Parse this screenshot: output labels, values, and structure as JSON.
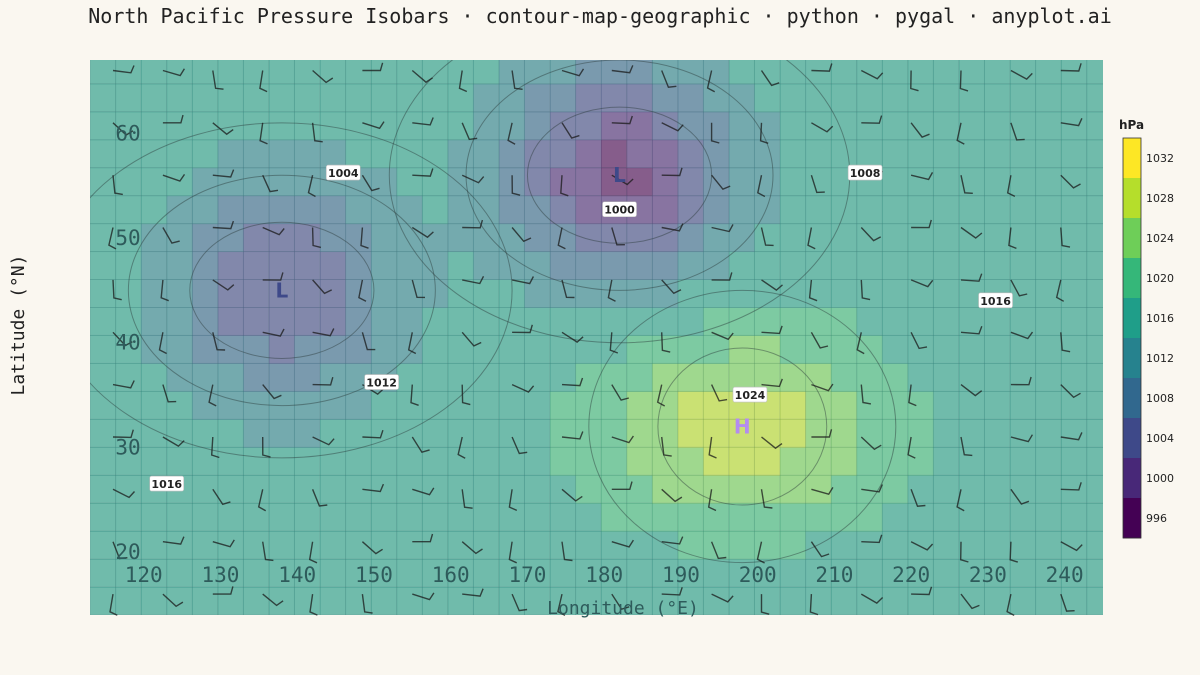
{
  "chart_data": {
    "type": "heatmap",
    "title": "North Pacific Pressure Isobars · contour-map-geographic · python · pygal · anyplot.ai",
    "xlabel": "Longitude (°E)",
    "ylabel": "Latitude (°N)",
    "xlim": [
      113,
      245
    ],
    "ylim": [
      14,
      67
    ],
    "x_ticks": [
      120,
      130,
      140,
      150,
      160,
      170,
      180,
      190,
      200,
      210,
      220,
      230,
      240
    ],
    "y_ticks": [
      20,
      30,
      40,
      50,
      60
    ],
    "grid": true,
    "colorbar": {
      "title": "hPa",
      "ticks": [
        "1032",
        "1028",
        "1024",
        "1020",
        "1016",
        "1012",
        "1008",
        "1004",
        "1000",
        "996"
      ],
      "range": [
        994,
        1034
      ],
      "colors": [
        "#440154",
        "#482878",
        "#3e4989",
        "#31688e",
        "#26828e",
        "#1f9e89",
        "#35b779",
        "#6ece58",
        "#b5de2b",
        "#fde725"
      ]
    },
    "pressure_centers": [
      {
        "type": "low",
        "label": "L",
        "lon": 138,
        "lat": 45,
        "hPa": 1002,
        "color": "#3e4989"
      },
      {
        "type": "low",
        "label": "L",
        "lon": 182,
        "lat": 56,
        "hPa": 997,
        "color": "#3e4989"
      },
      {
        "type": "high",
        "label": "H",
        "lon": 198,
        "lat": 32,
        "hPa": 1029,
        "color": "#b48cf0"
      }
    ],
    "isobar_labels": [
      {
        "text": "1004",
        "lon": 146,
        "lat": 56.2
      },
      {
        "text": "1000",
        "lon": 182,
        "lat": 52.7
      },
      {
        "text": "1008",
        "lon": 214,
        "lat": 56.2
      },
      {
        "text": "1016",
        "lon": 231,
        "lat": 44
      },
      {
        "text": "1012",
        "lon": 151,
        "lat": 36.2
      },
      {
        "text": "1024",
        "lon": 199,
        "lat": 35
      },
      {
        "text": "1016",
        "lon": 123,
        "lat": 26.5
      }
    ]
  }
}
